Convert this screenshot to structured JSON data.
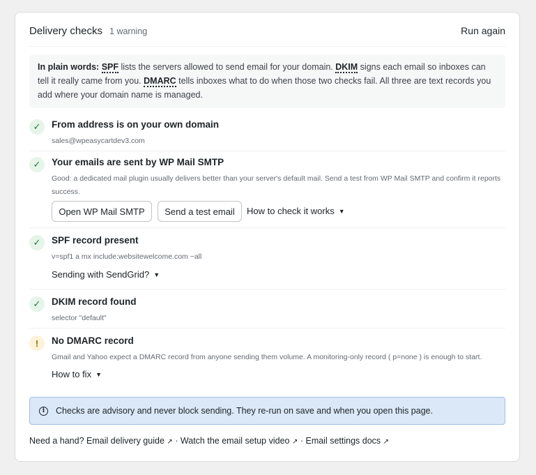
{
  "header": {
    "title": "Delivery checks",
    "warning_count": "1 warning",
    "run_again": "Run again"
  },
  "explanation": {
    "lead": "In plain words:",
    "spf": "SPF",
    "spf_text": " lists the servers allowed to send email for your domain. ",
    "dkim": "DKIM",
    "dkim_text": " signs each email so inboxes can tell it really came from you. ",
    "dmarc": "DMARC",
    "dmarc_text": " tells inboxes what to do when those two checks fail. All three are text records you add where your domain name is managed."
  },
  "checks": [
    {
      "status": "ok",
      "icon": "check-icon",
      "title": "From address is on your own domain",
      "detail": "sales@wpeasycartdev3.com"
    },
    {
      "status": "ok",
      "icon": "check-icon",
      "title": "Your emails are sent by WP Mail SMTP",
      "detail": "Good: a dedicated mail plugin usually delivers better than your server's default mail. Send a test from WP Mail SMTP and confirm it reports success.",
      "buttons": [
        "Open WP Mail SMTP",
        "Send a test email"
      ],
      "toggle": "How to check it works"
    },
    {
      "status": "ok",
      "icon": "check-icon",
      "title": "SPF record present",
      "detail": "v=spf1 a mx include:websitewelcome.com ~all",
      "toggle": "Sending with SendGrid?"
    },
    {
      "status": "ok",
      "icon": "check-icon",
      "title": "DKIM record found",
      "detail": "selector \"default\""
    },
    {
      "status": "warning",
      "icon": "exclamation-icon",
      "title": "No DMARC record",
      "detail": "Gmail and Yahoo expect a DMARC record from anyone sending them volume. A monitoring-only record ( p=none ) is enough to start.",
      "toggle": "How to fix"
    }
  ],
  "status_glyphs": {
    "ok": "✓",
    "warning": "!"
  },
  "notice": {
    "icon": "info-icon",
    "text": "Checks are advisory and never block sending. They re-run on save and when you open this page."
  },
  "footer": {
    "lead": "Need a hand?",
    "links": [
      "Email delivery guide",
      "Watch the email setup video",
      "Email settings docs"
    ],
    "separator": "·",
    "external_glyph": "↗"
  },
  "colors": {
    "ok": "#1e7a3a",
    "ok_bg": "#e6f4ea",
    "warning": "#8a6d00",
    "warning_bg": "#fcf3d9",
    "notice_bg": "#dbe8f8",
    "notice_border": "#9ec2e6"
  }
}
